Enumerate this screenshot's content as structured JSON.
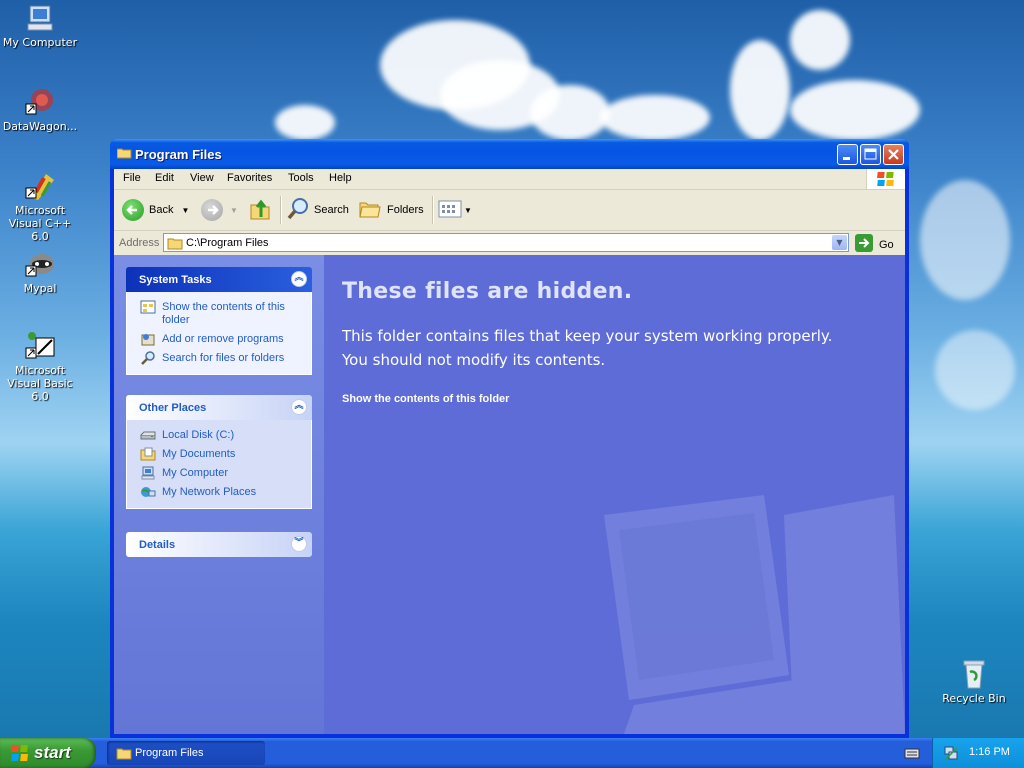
{
  "desktop": {
    "icons": [
      {
        "label": "My Computer"
      },
      {
        "label": "DataWagon..."
      },
      {
        "label": "Microsoft Visual C++ 6.0"
      },
      {
        "label": "Mypal"
      },
      {
        "label": "Microsoft Visual Basic 6.0"
      },
      {
        "label": "Recycle Bin"
      }
    ]
  },
  "window": {
    "title": "Program Files",
    "menu": [
      "File",
      "Edit",
      "View",
      "Favorites",
      "Tools",
      "Help"
    ],
    "toolbar": {
      "back": "Back",
      "search": "Search",
      "folders": "Folders"
    },
    "address": {
      "label": "Address",
      "value": "C:\\Program Files",
      "go": "Go"
    },
    "taskpane": {
      "system_tasks": {
        "title": "System Tasks",
        "items": [
          "Show the contents of this folder",
          "Add or remove programs",
          "Search for files or folders"
        ]
      },
      "other_places": {
        "title": "Other Places",
        "items": [
          "Local Disk (C:)",
          "My Documents",
          "My Computer",
          "My Network Places"
        ]
      },
      "details": {
        "title": "Details"
      }
    },
    "main": {
      "heading": "These files are hidden.",
      "line1": "This folder contains files that keep your system working properly.",
      "line2": "You should not modify its contents.",
      "link": "Show the contents of this folder"
    }
  },
  "taskbar": {
    "start": "start",
    "task": "Program Files",
    "clock": "1:16 PM"
  }
}
